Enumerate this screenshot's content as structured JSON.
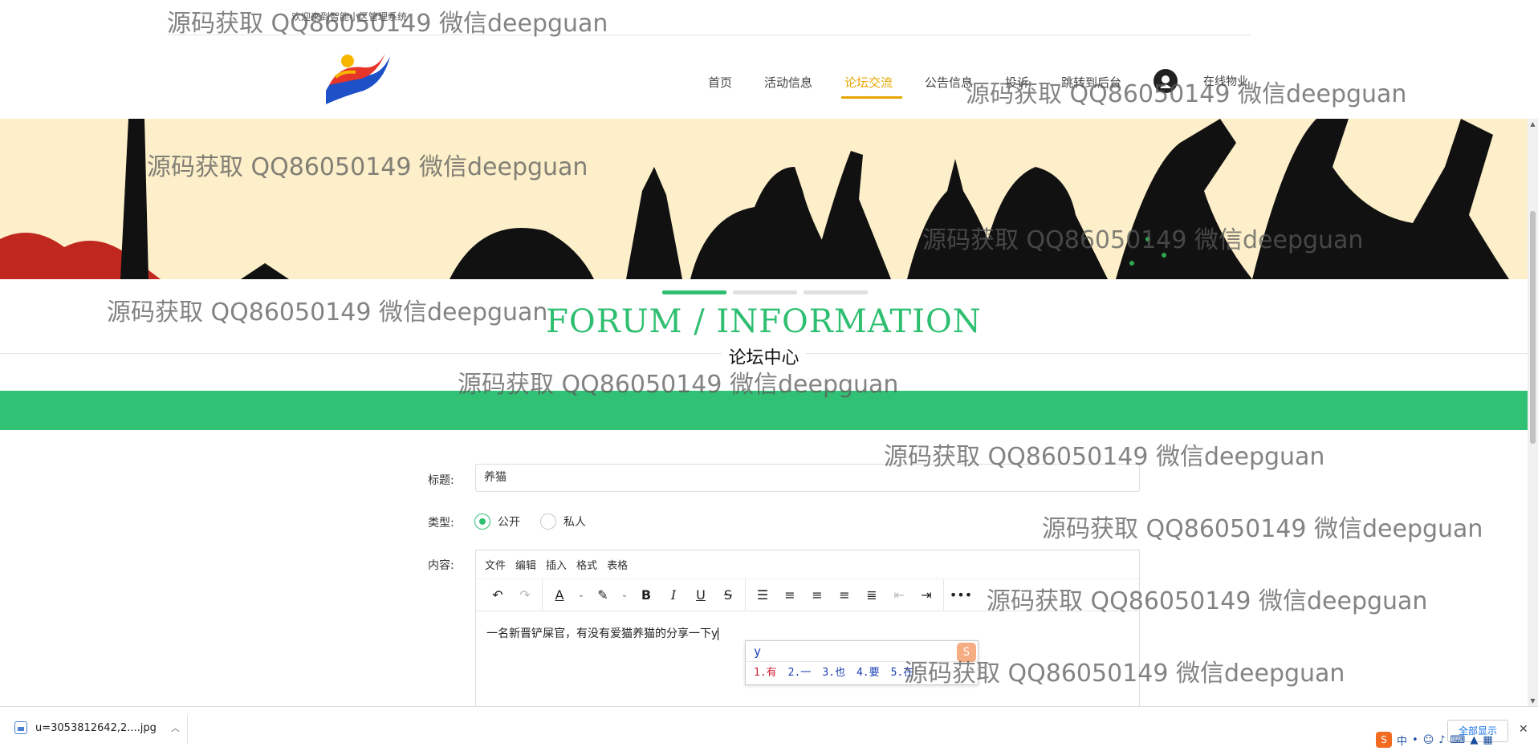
{
  "header": {
    "welcome": "欢迎来到智能小区管理系统",
    "nav": [
      {
        "label": "首页",
        "active": false
      },
      {
        "label": "活动信息",
        "active": false
      },
      {
        "label": "论坛交流",
        "active": true
      },
      {
        "label": "公告信息",
        "active": false
      },
      {
        "label": "投诉",
        "active": false
      },
      {
        "label": "跳转到后台",
        "active": false
      }
    ],
    "user_label": "在线物业"
  },
  "section": {
    "title_en": "FORUM / INFORMATION",
    "title_cn": "论坛中心"
  },
  "form": {
    "title_label": "标题:",
    "title_value": "养猫",
    "type_label": "类型:",
    "type_options": [
      {
        "label": "公开",
        "checked": true
      },
      {
        "label": "私人",
        "checked": false
      }
    ],
    "content_label": "内容:",
    "editor_menu": [
      "文件",
      "编辑",
      "插入",
      "格式",
      "表格"
    ],
    "editor_text": "一名新晋铲屎官，有没有爱猫养猫的分享一下y"
  },
  "ime": {
    "input": "y",
    "candidates": [
      "1.有",
      "2.一",
      "3.也",
      "4.要",
      "5.在"
    ]
  },
  "download_bar": {
    "file_name": "u=3053812642,2....jpg",
    "show_all": "全部显示"
  },
  "tray": {
    "text": "中"
  },
  "watermark": "源码获取 QQ86050149 微信deepguan",
  "colors": {
    "accent_green": "#31c174",
    "nav_active": "#e6a700",
    "banner_bg": "#fcefc9"
  }
}
